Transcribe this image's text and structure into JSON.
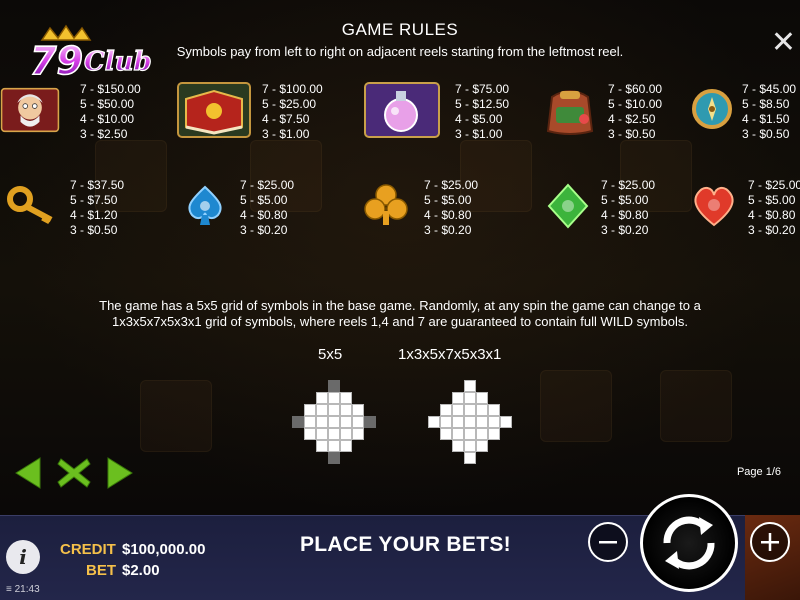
{
  "header": {
    "title": "GAME RULES",
    "subtitle": "Symbols pay from left to right on adjacent reels starting from the leftmost reel.",
    "close_label": "✕"
  },
  "logo": {
    "text": "79Club"
  },
  "paytable": [
    {
      "icon": "old-man-icon",
      "lines": [
        "7 - $150.00",
        "5 - $50.00",
        "4 - $10.00",
        "3 - $2.50"
      ]
    },
    {
      "icon": "spellbook-icon",
      "lines": [
        "7 - $100.00",
        "5 - $25.00",
        "4 - $7.50",
        "3 - $1.00"
      ]
    },
    {
      "icon": "potion-icon",
      "lines": [
        "7 - $75.00",
        "5 - $12.50",
        "4 - $5.00",
        "3 - $1.00"
      ]
    },
    {
      "icon": "backpack-icon",
      "lines": [
        "7 - $60.00",
        "5 - $10.00",
        "4 - $2.50",
        "3 - $0.50"
      ]
    },
    {
      "icon": "compass-icon",
      "lines": [
        "7 - $45.00",
        "5 - $8.50",
        "4 - $1.50",
        "3 - $0.50"
      ]
    },
    {
      "icon": "key-icon",
      "lines": [
        "7 - $37.50",
        "5 - $7.50",
        "4 - $1.20",
        "3 - $0.50"
      ]
    },
    {
      "icon": "spade-icon",
      "lines": [
        "7 - $25.00",
        "5 - $5.00",
        "4 - $0.80",
        "3 - $0.20"
      ]
    },
    {
      "icon": "club-icon",
      "lines": [
        "7 - $25.00",
        "5 - $5.00",
        "4 - $0.80",
        "3 - $0.20"
      ]
    },
    {
      "icon": "diamond-icon",
      "lines": [
        "7 - $25.00",
        "5 - $5.00",
        "4 - $0.80",
        "3 - $0.20"
      ]
    },
    {
      "icon": "heart-icon",
      "lines": [
        "7 - $25.00",
        "5 - $5.00",
        "4 - $0.80",
        "3 - $0.20"
      ]
    }
  ],
  "description": {
    "line1": "The game has a 5x5 grid of symbols in the base game. Randomly, at any spin the game can change to a",
    "line2": "1x3x5x7x5x3x1 grid of symbols, where reels 1,4 and 7 are guaranteed to contain full WILD symbols."
  },
  "grids": {
    "small_label": "5x5",
    "large_label": "1x3x5x7x5x3x1"
  },
  "pagination": {
    "label": "Page 1/6"
  },
  "nav": {
    "prev_icon": "arrow-left-icon",
    "close_icon": "close-x-icon",
    "next_icon": "arrow-right-icon"
  },
  "bottom_bar": {
    "credit_label": "CREDIT",
    "credit_value": "$100,000.00",
    "bet_label": "BET",
    "bet_value": "$2.00",
    "message": "PLACE YOUR BETS!",
    "time": "21:43",
    "info_label": "i"
  },
  "colors": {
    "gold": "#f5c04a",
    "green": "#6bbf1f",
    "bar": "#1c1f3e"
  }
}
